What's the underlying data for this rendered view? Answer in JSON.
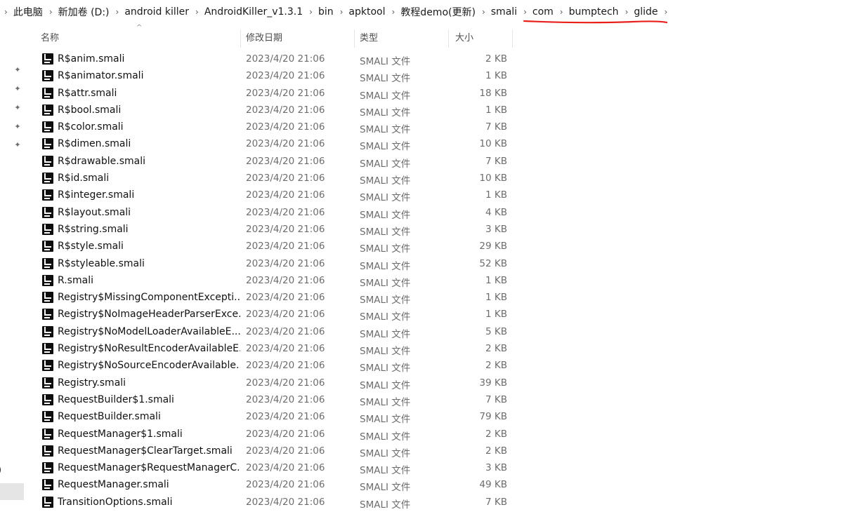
{
  "breadcrumb": [
    "此电脑",
    "新加卷 (D:)",
    "android killer",
    "AndroidKiller_v1.3.1",
    "bin",
    "apktool",
    "教程demo(更新)",
    "smali",
    "com",
    "bumptech",
    "glide"
  ],
  "breadcrumb_separator": "›",
  "columns": {
    "name": "名称",
    "date": "修改日期",
    "type": "类型",
    "size": "大小"
  },
  "nav": {
    "partial_text": ")"
  },
  "files": [
    {
      "name": "R$anim.smali",
      "date": "2023/4/20 21:06",
      "type": "SMALI 文件",
      "size": "2 KB"
    },
    {
      "name": "R$animator.smali",
      "date": "2023/4/20 21:06",
      "type": "SMALI 文件",
      "size": "1 KB"
    },
    {
      "name": "R$attr.smali",
      "date": "2023/4/20 21:06",
      "type": "SMALI 文件",
      "size": "18 KB"
    },
    {
      "name": "R$bool.smali",
      "date": "2023/4/20 21:06",
      "type": "SMALI 文件",
      "size": "1 KB"
    },
    {
      "name": "R$color.smali",
      "date": "2023/4/20 21:06",
      "type": "SMALI 文件",
      "size": "7 KB"
    },
    {
      "name": "R$dimen.smali",
      "date": "2023/4/20 21:06",
      "type": "SMALI 文件",
      "size": "10 KB"
    },
    {
      "name": "R$drawable.smali",
      "date": "2023/4/20 21:06",
      "type": "SMALI 文件",
      "size": "7 KB"
    },
    {
      "name": "R$id.smali",
      "date": "2023/4/20 21:06",
      "type": "SMALI 文件",
      "size": "10 KB"
    },
    {
      "name": "R$integer.smali",
      "date": "2023/4/20 21:06",
      "type": "SMALI 文件",
      "size": "1 KB"
    },
    {
      "name": "R$layout.smali",
      "date": "2023/4/20 21:06",
      "type": "SMALI 文件",
      "size": "4 KB"
    },
    {
      "name": "R$string.smali",
      "date": "2023/4/20 21:06",
      "type": "SMALI 文件",
      "size": "3 KB"
    },
    {
      "name": "R$style.smali",
      "date": "2023/4/20 21:06",
      "type": "SMALI 文件",
      "size": "29 KB"
    },
    {
      "name": "R$styleable.smali",
      "date": "2023/4/20 21:06",
      "type": "SMALI 文件",
      "size": "52 KB"
    },
    {
      "name": "R.smali",
      "date": "2023/4/20 21:06",
      "type": "SMALI 文件",
      "size": "1 KB"
    },
    {
      "name": "Registry$MissingComponentExcepti...",
      "date": "2023/4/20 21:06",
      "type": "SMALI 文件",
      "size": "1 KB"
    },
    {
      "name": "Registry$NoImageHeaderParserExce...",
      "date": "2023/4/20 21:06",
      "type": "SMALI 文件",
      "size": "1 KB"
    },
    {
      "name": "Registry$NoModelLoaderAvailableE...",
      "date": "2023/4/20 21:06",
      "type": "SMALI 文件",
      "size": "5 KB"
    },
    {
      "name": "Registry$NoResultEncoderAvailableE...",
      "date": "2023/4/20 21:06",
      "type": "SMALI 文件",
      "size": "2 KB"
    },
    {
      "name": "Registry$NoSourceEncoderAvailable...",
      "date": "2023/4/20 21:06",
      "type": "SMALI 文件",
      "size": "2 KB"
    },
    {
      "name": "Registry.smali",
      "date": "2023/4/20 21:06",
      "type": "SMALI 文件",
      "size": "39 KB"
    },
    {
      "name": "RequestBuilder$1.smali",
      "date": "2023/4/20 21:06",
      "type": "SMALI 文件",
      "size": "7 KB"
    },
    {
      "name": "RequestBuilder.smali",
      "date": "2023/4/20 21:06",
      "type": "SMALI 文件",
      "size": "79 KB"
    },
    {
      "name": "RequestManager$1.smali",
      "date": "2023/4/20 21:06",
      "type": "SMALI 文件",
      "size": "2 KB"
    },
    {
      "name": "RequestManager$ClearTarget.smali",
      "date": "2023/4/20 21:06",
      "type": "SMALI 文件",
      "size": "2 KB"
    },
    {
      "name": "RequestManager$RequestManagerC...",
      "date": "2023/4/20 21:06",
      "type": "SMALI 文件",
      "size": "3 KB"
    },
    {
      "name": "RequestManager.smali",
      "date": "2023/4/20 21:06",
      "type": "SMALI 文件",
      "size": "49 KB"
    },
    {
      "name": "TransitionOptions.smali",
      "date": "2023/4/20 21:06",
      "type": "SMALI 文件",
      "size": "7 KB"
    }
  ],
  "colors": {
    "annotation_red": "#e8201c",
    "file_icon_bg": "#0e0e0e",
    "muted_text": "#6d6d6d",
    "nav_selected": "#e5e5e5"
  },
  "icons": {
    "file": "intellij-file-icon",
    "pin": "pin-icon",
    "breadcrumb_sep": "chevron-right-icon",
    "sort": "sort-caret-icon"
  }
}
